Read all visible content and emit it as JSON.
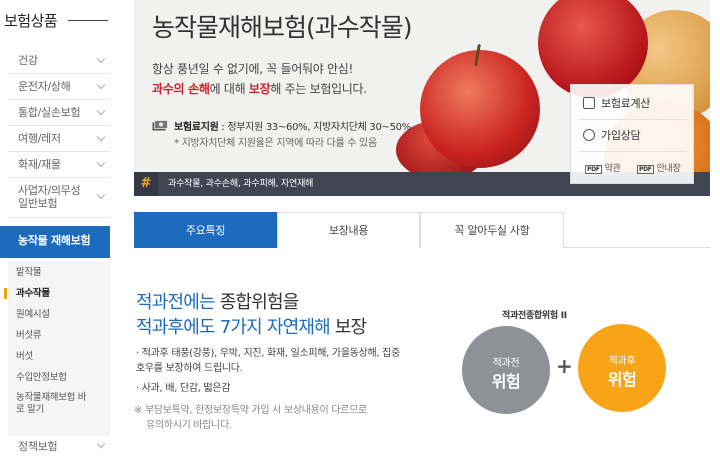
{
  "sidebar": {
    "title": "보험상품",
    "menu": [
      {
        "label": "건강"
      },
      {
        "label": "운전자/상해"
      },
      {
        "label": "통합/실손보험"
      },
      {
        "label": "여행/레저"
      },
      {
        "label": "화재/재물"
      },
      {
        "label": "사업자/의무성 일반보험"
      }
    ],
    "active_section": "농작물 재해보험",
    "submenu": [
      {
        "label": "밭작물"
      },
      {
        "label": "과수작물"
      },
      {
        "label": "원예시설"
      },
      {
        "label": "버섯류"
      },
      {
        "label": "버섯"
      },
      {
        "label": "수입안정보험"
      },
      {
        "label": "농작물재해보험 바로 알기"
      }
    ],
    "last_item": "정책보험"
  },
  "banner": {
    "title": "농작물재해보험(과수작물)",
    "line1": "항상 풍년일 수 없기에, 꼭 들어둬야 안심!",
    "line2_red": "과수의 손해",
    "line2_mid": "에 대해 ",
    "line2_red2": "보장",
    "line2_end": "해 주는 보험입니다.",
    "subsidy_label": "보험료지원",
    "subsidy_text": " : 정부지원 33~60%, 지방자치단체 30~50%",
    "subsidy_note": "* 지방자치단체 지원율은 지역에 따라 다를 수 있음",
    "tags": "과수작물,  과수손해,  과수피해,  자연재해",
    "hash": "#"
  },
  "quick": {
    "calc": "보험료계산",
    "consult": "가입상담",
    "pdf1": "약관",
    "pdf2": "안내장",
    "pdf_badge": "PDF"
  },
  "tabs": [
    {
      "label": "주요특징"
    },
    {
      "label": "보장내용"
    },
    {
      "label": "꼭 알아두실 사항"
    }
  ],
  "content": {
    "headline1_blue": "적과전에는",
    "headline1_rest": " 종합위험을",
    "headline2_blue": "적과후에도 7가지 자연재해",
    "headline2_rest": " 보장",
    "bullet1": "· 적과후 태풍(강풍), 우박, 지진, 화재, 일소피해, 가을동상해, 집중호우를 보장하여 드립니다.",
    "bullet2": "· 사과, 배, 단감, 떫은감",
    "note1": "※ 부담보특약, 한정보장특약 가입 시 보상내용이 다르므로",
    "note2": "유의하시기 바랍니다."
  },
  "diagram": {
    "caption": "적과전종합위험 II",
    "left_small": "적과전",
    "left_big": "위험",
    "plus": "+",
    "right_small": "적과후",
    "right_big": "위험"
  },
  "colors": {
    "accent_blue": "#1d6bbf",
    "accent_orange": "#f8a417",
    "accent_red": "#d1222a",
    "tagbar": "#3f4652"
  },
  "icons": [
    "chevron-down-icon",
    "money-icon",
    "calculator-icon",
    "chat-icon",
    "pdf-icon",
    "hash-icon"
  ]
}
